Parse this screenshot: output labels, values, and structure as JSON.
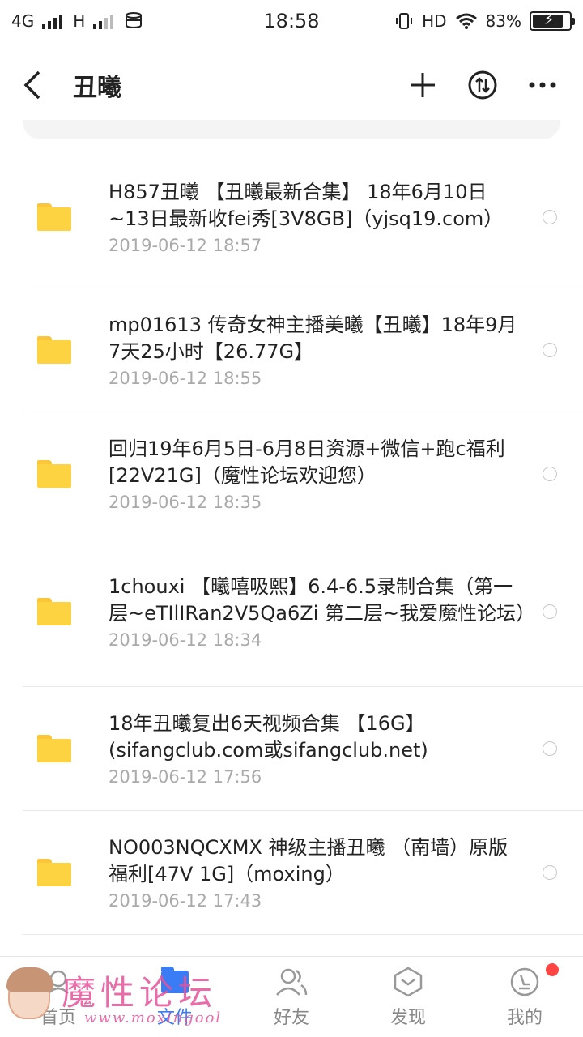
{
  "status_bar": {
    "network_left": "4G",
    "network_right": "H",
    "time": "18:58",
    "hd": "HD",
    "battery": "83%",
    "battery_level": 0.83
  },
  "header": {
    "title": "丑曦",
    "back_icon": "back-arrow-icon",
    "add_icon": "plus-icon",
    "sort_icon": "sort-icon",
    "more_icon": "more-icon"
  },
  "files": [
    {
      "name": "H857丑曦 【丑曦最新合集】 18年6月10日~13日最新收fei秀[3V8GB]（yjsq19.com）",
      "date": "2019-06-12  18:57"
    },
    {
      "name": "mp01613  传奇女神主播美曦【丑曦】18年9月7天25小时【26.77G】",
      "date": "2019-06-12  18:55"
    },
    {
      "name": "回归19年6月5日-6月8日资源+微信+跑c福利[22V21G]（魔性论坛欢迎您）",
      "date": "2019-06-12  18:35"
    },
    {
      "name": "1chouxi 【曦嘻吸熙】6.4-6.5录制合集（第一层~eTIlIRan2V5Qa6Zi 第二层~我爱魔性论坛）",
      "date": "2019-06-12  18:34"
    },
    {
      "name": "18年丑曦复出6天视频合集 【16G】(sifangclub.com或sifangclub.net)",
      "date": "2019-06-12  17:56"
    },
    {
      "name": "NO003NQCXMX 神级主播丑曦 （南墙）原版福利[47V 1G]（moxing）",
      "date": "2019-06-12  17:43"
    }
  ],
  "bottom_nav": [
    {
      "label": "首页",
      "icon": "home-icon"
    },
    {
      "label": "文件",
      "icon": "folder-icon",
      "active": true
    },
    {
      "label": "好友",
      "icon": "friends-icon"
    },
    {
      "label": "发现",
      "icon": "discover-icon"
    },
    {
      "label": "我的",
      "icon": "profile-icon",
      "badge": true
    }
  ],
  "watermark": {
    "title": "魔性论坛",
    "url": "www.moxingool"
  },
  "colors": {
    "accent": "#3a7cf5",
    "folder": "#fdd341",
    "badge": "#ff4444",
    "watermark": "#e6539a"
  }
}
